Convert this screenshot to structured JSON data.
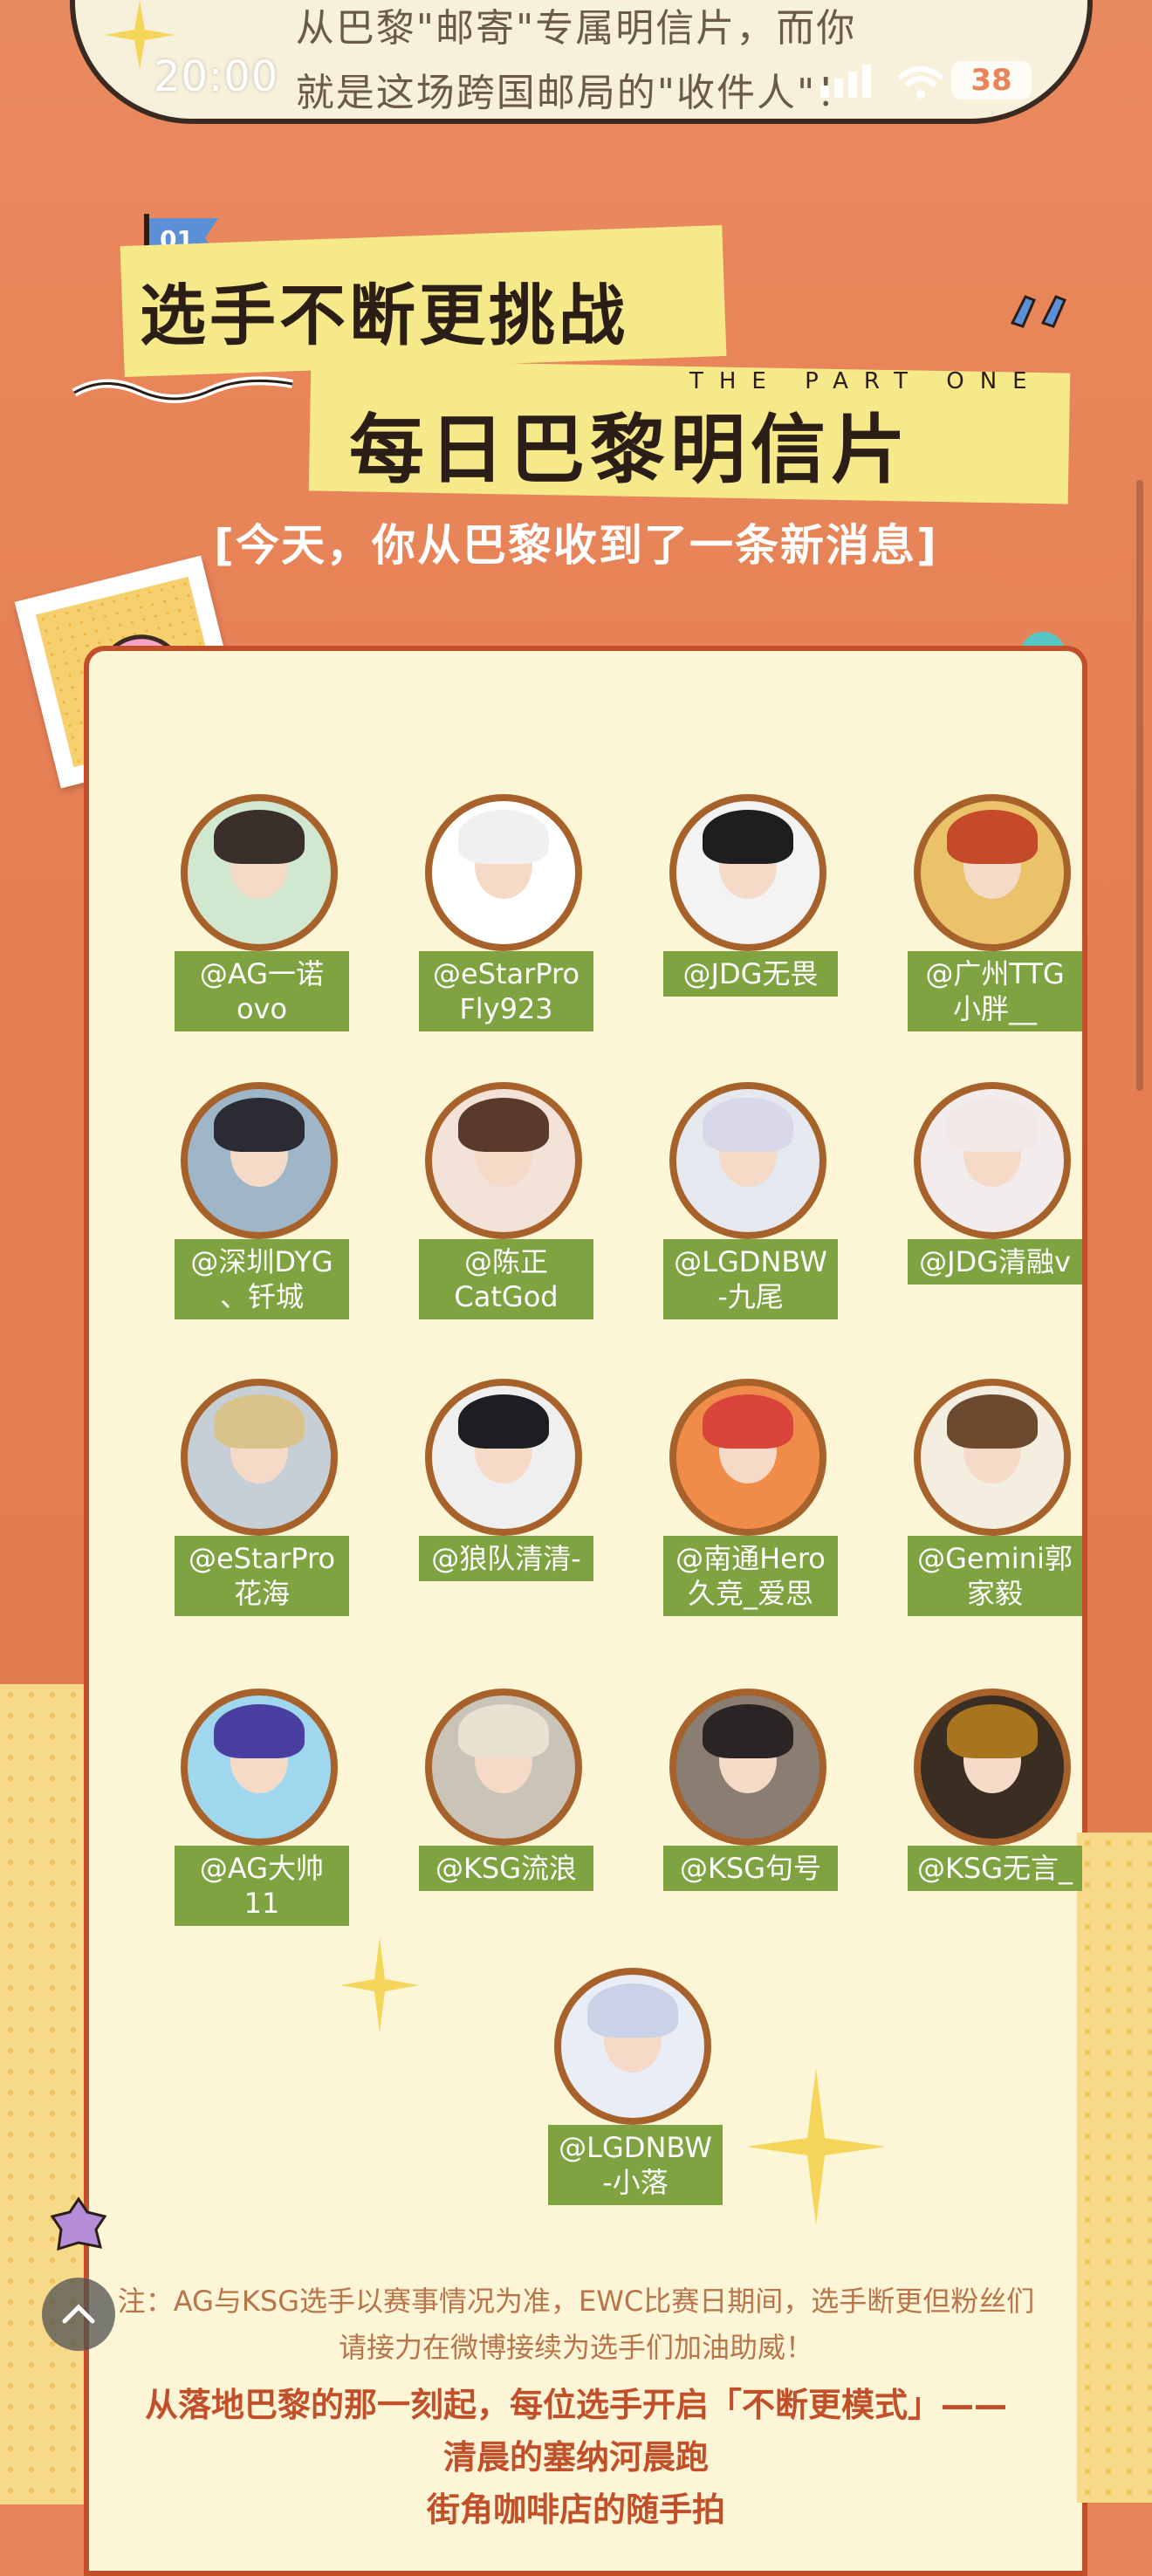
{
  "status_bar": {
    "time": "20:00",
    "battery": "38"
  },
  "top_note": {
    "line1": "从巴黎\"邮寄\"专属明信片，而你",
    "line2": "就是这场跨国邮局的\"收件人\"！"
  },
  "header": {
    "badge": "01",
    "title_line1": "选手不断更挑战",
    "title_line2": "每日巴黎明信片",
    "part_label": "THE PART ONE",
    "subtitle": "[今天，你从巴黎收到了一条新消息]"
  },
  "players": [
    {
      "name": "@AG一诺ovo"
    },
    {
      "name": "@eStarPro\nFly923"
    },
    {
      "name": "@JDG无畏"
    },
    {
      "name": "@广州TTG\n小胖__"
    },
    {
      "name": "@深圳DYG\n、钎城"
    },
    {
      "name": "@陈正CatGod"
    },
    {
      "name": "@LGDNBW\n-九尾"
    },
    {
      "name": "@JDG清融v"
    },
    {
      "name": "@eStarPro\n花海"
    },
    {
      "name": "@狼队清清-"
    },
    {
      "name": "@南通Hero\n久竞_爱思"
    },
    {
      "name": "@Gemini郭家毅"
    },
    {
      "name": "@AG大帅11"
    },
    {
      "name": "@KSG流浪"
    },
    {
      "name": "@KSG句号"
    },
    {
      "name": "@KSG无言_"
    },
    {
      "name": "@LGDNBW\n-小落"
    }
  ],
  "footer": {
    "note_line1": "注：AG与KSG选手以赛事情况为准，EWC比赛日期间，选手断更但粉丝们",
    "note_line2": "请接力在微博接续为选手们加油助威！",
    "bold_line1": "从落地巴黎的那一刻起，每位选手开启「不断更模式」——",
    "bold_line2": "清晨的塞纳河晨跑",
    "bold_line3": "街角咖啡店的随手拍"
  },
  "colors": {
    "background": "#e8845a",
    "panel": "#fcf6d6",
    "tag": "#7ea340",
    "tape": "#f5e98a",
    "ring": "#a7622b"
  },
  "icons": [
    "sparkle-icon",
    "signal-icon",
    "wifi-icon",
    "battery-icon",
    "back-to-top-icon",
    "flag-icon"
  ]
}
